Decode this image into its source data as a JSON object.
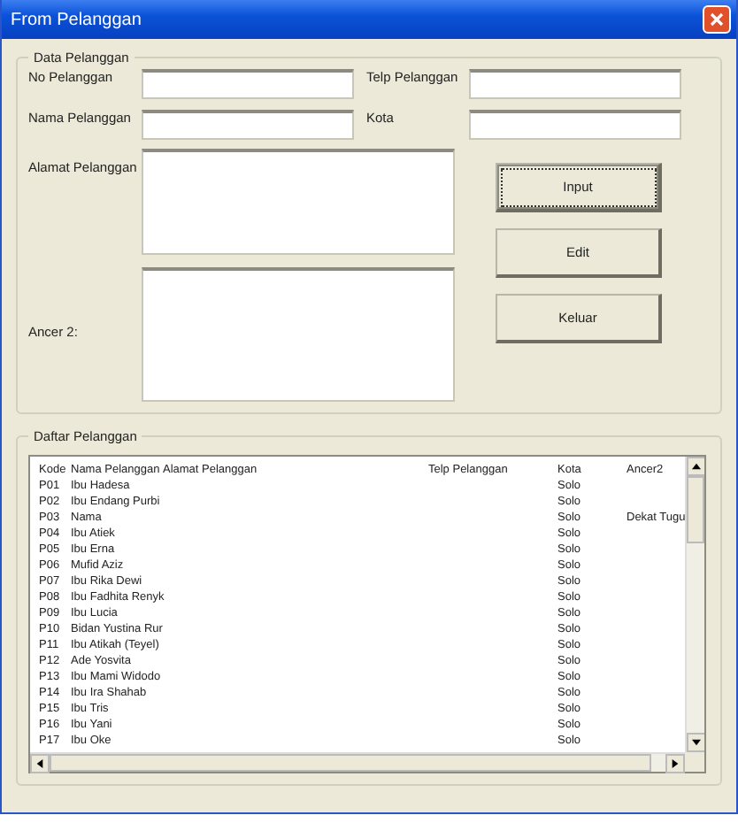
{
  "window": {
    "title": "From Pelanggan"
  },
  "data_group": {
    "legend": "Data Pelanggan",
    "fields": [
      {
        "label": "No Pelanggan"
      },
      {
        "label": "Telp Pelanggan"
      },
      {
        "label": "Nama Pelanggan"
      },
      {
        "label": "Kota"
      }
    ],
    "alamat": {
      "label": "Alamat Pelanggan"
    },
    "ancer": {
      "label": "Ancer 2:"
    },
    "buttons": [
      {
        "label": "Input",
        "focused": true
      },
      {
        "label": "Edit",
        "focused": false
      },
      {
        "label": "Keluar",
        "focused": false
      }
    ]
  },
  "list_group": {
    "legend": "Daftar Pelanggan",
    "columns": [
      "Kode",
      "Nama Pelanggan",
      "Alamat Pelanggan",
      "Telp Pelanggan",
      "Kota",
      "Ancer2"
    ],
    "rows": [
      [
        "P01",
        "Ibu Hadesa",
        "",
        "",
        "Solo",
        ""
      ],
      [
        "P02",
        "Ibu Endang Purbi",
        "",
        "",
        "Solo",
        ""
      ],
      [
        "P03",
        "Nama",
        "",
        "",
        "Solo",
        "Dekat Tugu"
      ],
      [
        "P04",
        "Ibu Atiek",
        "",
        "",
        "Solo",
        ""
      ],
      [
        "P05",
        "Ibu Erna",
        "",
        "",
        "Solo",
        ""
      ],
      [
        "P06",
        "Mufid Aziz",
        "",
        "",
        "Solo",
        ""
      ],
      [
        "P07",
        "Ibu Rika Dewi",
        "",
        "",
        "Solo",
        ""
      ],
      [
        "P08",
        "Ibu Fadhita Renyk",
        "",
        "",
        "Solo",
        ""
      ],
      [
        "P09",
        "Ibu Lucia",
        "",
        "",
        "Solo",
        ""
      ],
      [
        "P10",
        "Bidan Yustina Rur",
        "",
        "",
        "Solo",
        ""
      ],
      [
        "P11",
        "Ibu Atikah (Teyel)",
        "",
        "",
        "Solo",
        ""
      ],
      [
        "P12",
        "Ade Yosvita",
        "",
        "",
        "Solo",
        ""
      ],
      [
        "P13",
        "Ibu Mami Widodo",
        "",
        "",
        "Solo",
        ""
      ],
      [
        "P14",
        "Ibu Ira Shahab",
        "",
        "",
        "Solo",
        ""
      ],
      [
        "P15",
        "Ibu Tris",
        "",
        "",
        "Solo",
        ""
      ],
      [
        "P16",
        "Ibu Yani",
        "",
        "",
        "Solo",
        ""
      ],
      [
        "P17",
        "Ibu Oke",
        "",
        "",
        "Solo",
        ""
      ]
    ]
  }
}
